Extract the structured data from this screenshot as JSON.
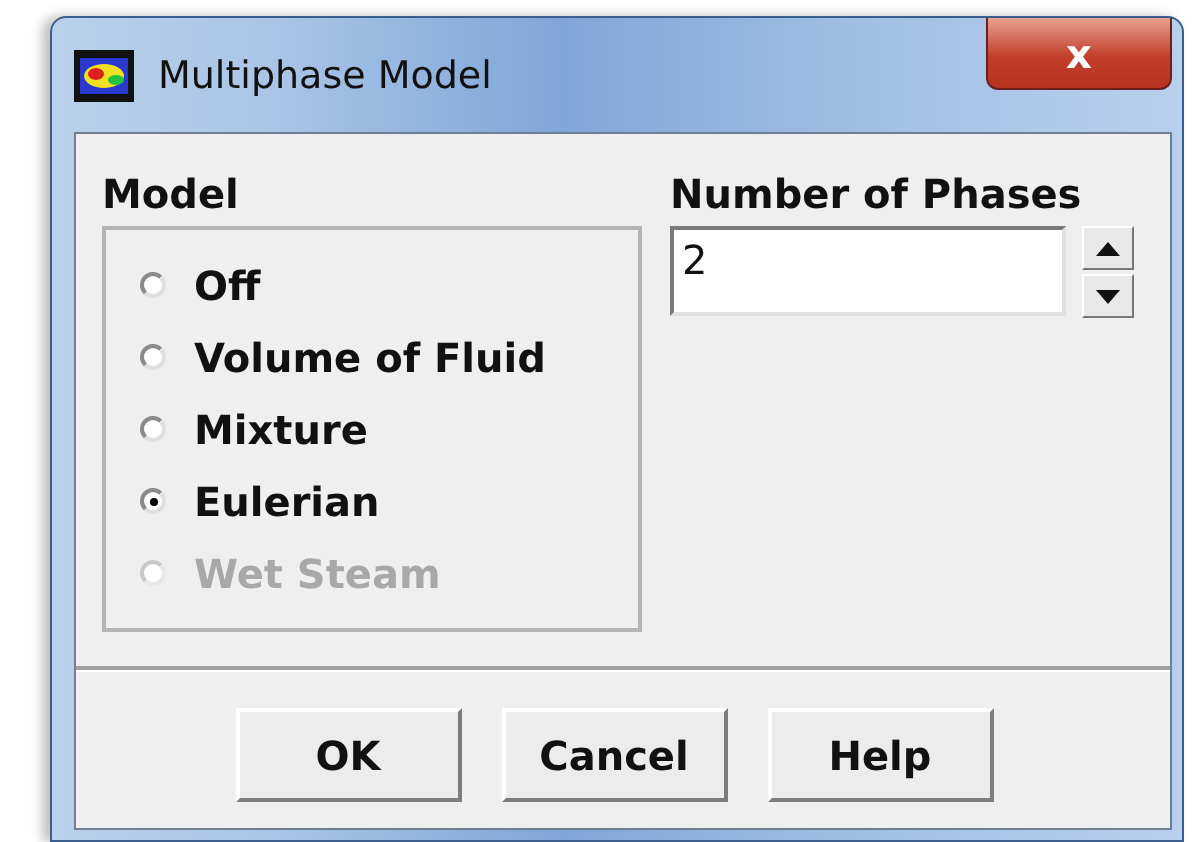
{
  "window": {
    "title": "Multiphase Model",
    "close": "x"
  },
  "model": {
    "label": "Model",
    "options": [
      {
        "label": "Off",
        "selected": false,
        "disabled": false
      },
      {
        "label": "Volume of Fluid",
        "selected": false,
        "disabled": false
      },
      {
        "label": "Mixture",
        "selected": false,
        "disabled": false
      },
      {
        "label": "Eulerian",
        "selected": true,
        "disabled": false
      },
      {
        "label": "Wet Steam",
        "selected": false,
        "disabled": true
      }
    ]
  },
  "phases": {
    "label": "Number of Phases",
    "value": "2"
  },
  "buttons": [
    "OK",
    "Cancel",
    "Help"
  ]
}
